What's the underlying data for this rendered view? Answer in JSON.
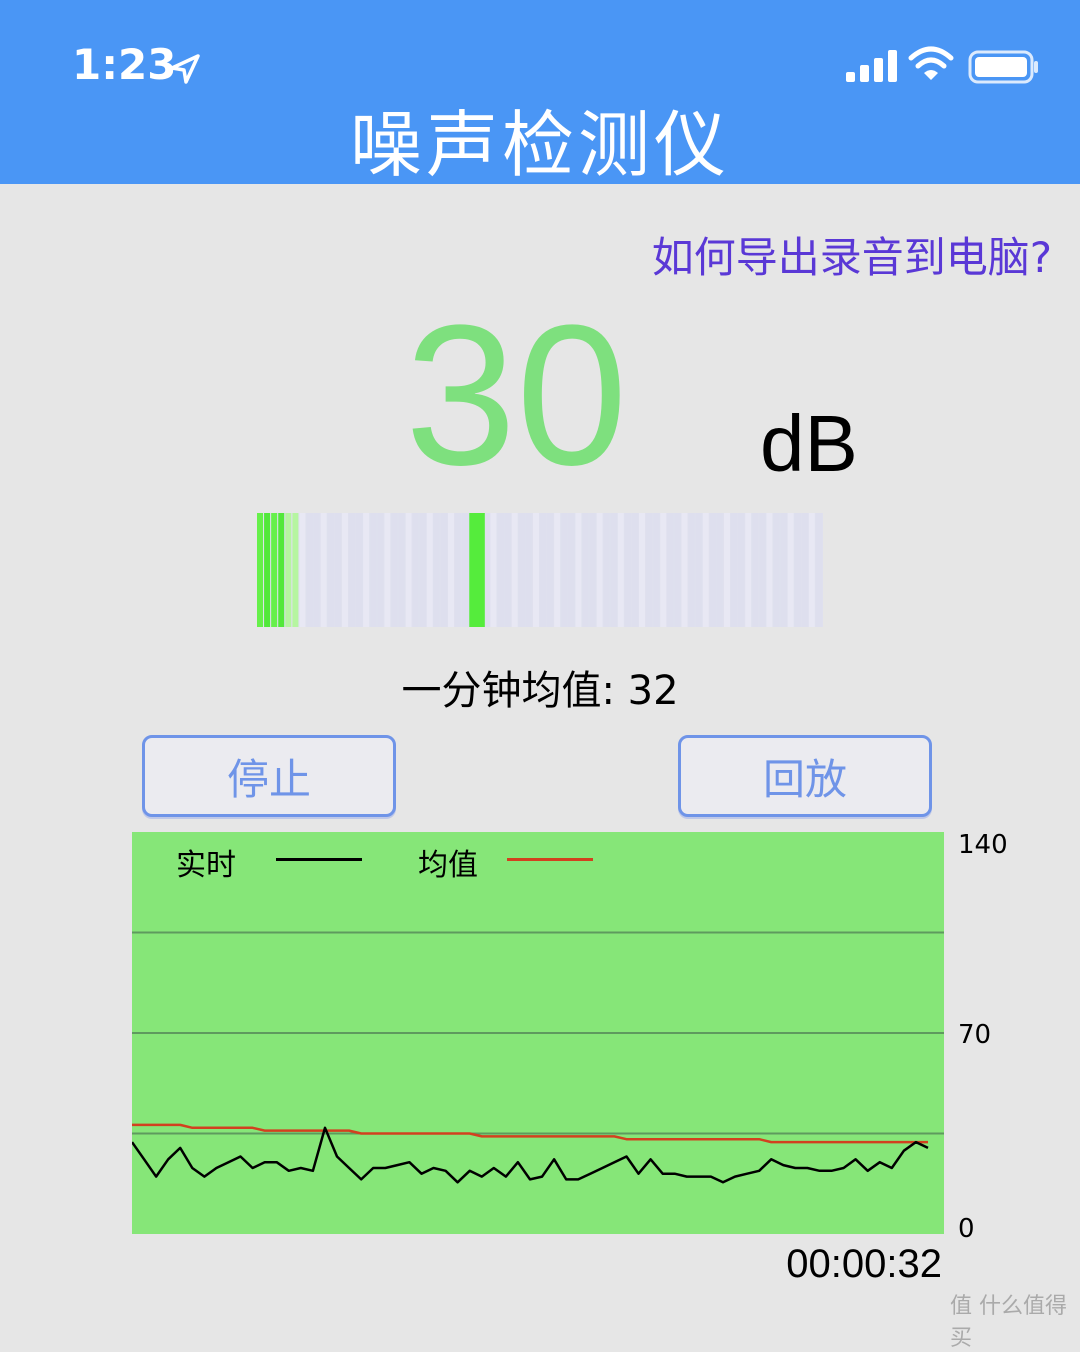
{
  "status_bar": {
    "time": "1:23"
  },
  "header": {
    "title": "噪声检测仪"
  },
  "help_link": "如何导出录音到电脑?",
  "reading": {
    "value": "30",
    "unit": "dB"
  },
  "level_meter": {
    "level_fraction": 0.05
  },
  "average": {
    "label": "一分钟均值: 32"
  },
  "buttons": {
    "stop": "停止",
    "replay": "回放"
  },
  "chart_data": {
    "type": "line",
    "legend": [
      {
        "name": "实时",
        "color": "#000000"
      },
      {
        "name": "均值",
        "color": "#d2411f"
      }
    ],
    "ylim": [
      0,
      140
    ],
    "yticks": [
      "140",
      "70",
      "0"
    ],
    "grid": true,
    "series": [
      {
        "name": "实时",
        "values": [
          32,
          26,
          20,
          26,
          30,
          23,
          20,
          23,
          25,
          27,
          23,
          25,
          25,
          22,
          23,
          22,
          37,
          27,
          23,
          19,
          23,
          23,
          24,
          25,
          21,
          23,
          22,
          18,
          22,
          20,
          23,
          20,
          25,
          19,
          20,
          26,
          19,
          19,
          21,
          23,
          25,
          27,
          21,
          26,
          21,
          21,
          20,
          20,
          20,
          18,
          20,
          21,
          22,
          26,
          24,
          23,
          23,
          22,
          22,
          23,
          26,
          22,
          25,
          23,
          29,
          32,
          30
        ]
      },
      {
        "name": "均值",
        "values": [
          38,
          38,
          38,
          38,
          38,
          37,
          37,
          37,
          37,
          37,
          37,
          36,
          36,
          36,
          36,
          36,
          36,
          36,
          36,
          35,
          35,
          35,
          35,
          35,
          35,
          35,
          35,
          35,
          35,
          34,
          34,
          34,
          34,
          34,
          34,
          34,
          34,
          34,
          34,
          34,
          34,
          33,
          33,
          33,
          33,
          33,
          33,
          33,
          33,
          33,
          33,
          33,
          33,
          32,
          32,
          32,
          32,
          32,
          32,
          32,
          32,
          32,
          32,
          32,
          32,
          32,
          32
        ]
      }
    ]
  },
  "timer": "00:00:32",
  "watermark": "值 什么值得买"
}
